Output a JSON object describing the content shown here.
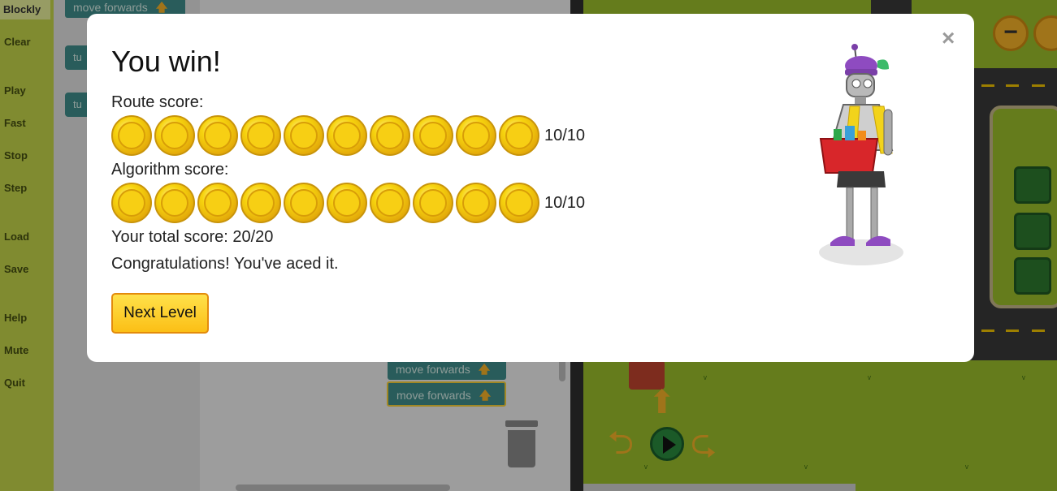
{
  "menu": {
    "tab": "Blockly",
    "items": [
      "Clear",
      "Play",
      "Fast",
      "Stop",
      "Step",
      "Load",
      "Save",
      "Help",
      "Mute",
      "Quit"
    ]
  },
  "workspace": {
    "toolbox_block": "move forwards",
    "toolbox_stub_1": "tu",
    "toolbox_stub_2": "tu",
    "blocks": [
      "move forwards",
      "move forwards"
    ]
  },
  "map": {
    "zoom_out_label": "−"
  },
  "modal": {
    "title": "You win!",
    "route_label": "Route score:",
    "route_score": "10/10",
    "route_coins": 10,
    "algorithm_label": "Algorithm score:",
    "algorithm_score": "10/10",
    "algorithm_coins": 10,
    "total": "Your total score: 20/20",
    "message": "Congratulations! You've aced it.",
    "next_button": "Next Level",
    "close_label": "×"
  },
  "colors": {
    "menu": "#c5d64a",
    "block": "#3f8e8c",
    "map_grass": "#9cbf2c",
    "coin": "#f7d40e",
    "button": "#fbbf16"
  }
}
